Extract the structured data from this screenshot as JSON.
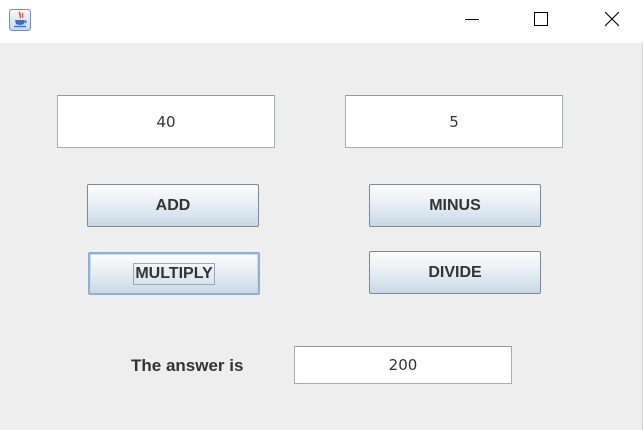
{
  "window": {
    "title": "",
    "icon": "java-cup-icon",
    "controls": {
      "minimize": "minimize-icon",
      "maximize": "maximize-icon",
      "close": "close-icon"
    }
  },
  "inputs": {
    "first_number": "40",
    "second_number": "5"
  },
  "buttons": {
    "add": "ADD",
    "minus": "MINUS",
    "multiply": "MULTIPLY",
    "divide": "DIVIDE",
    "focused": "multiply"
  },
  "result": {
    "label": "The answer is",
    "value": "200"
  },
  "colors": {
    "window_bg": "#eeeeee",
    "titlebar_bg": "#ffffff",
    "button_gradient_bottom": "#c8d7e5",
    "text": "#333333"
  }
}
